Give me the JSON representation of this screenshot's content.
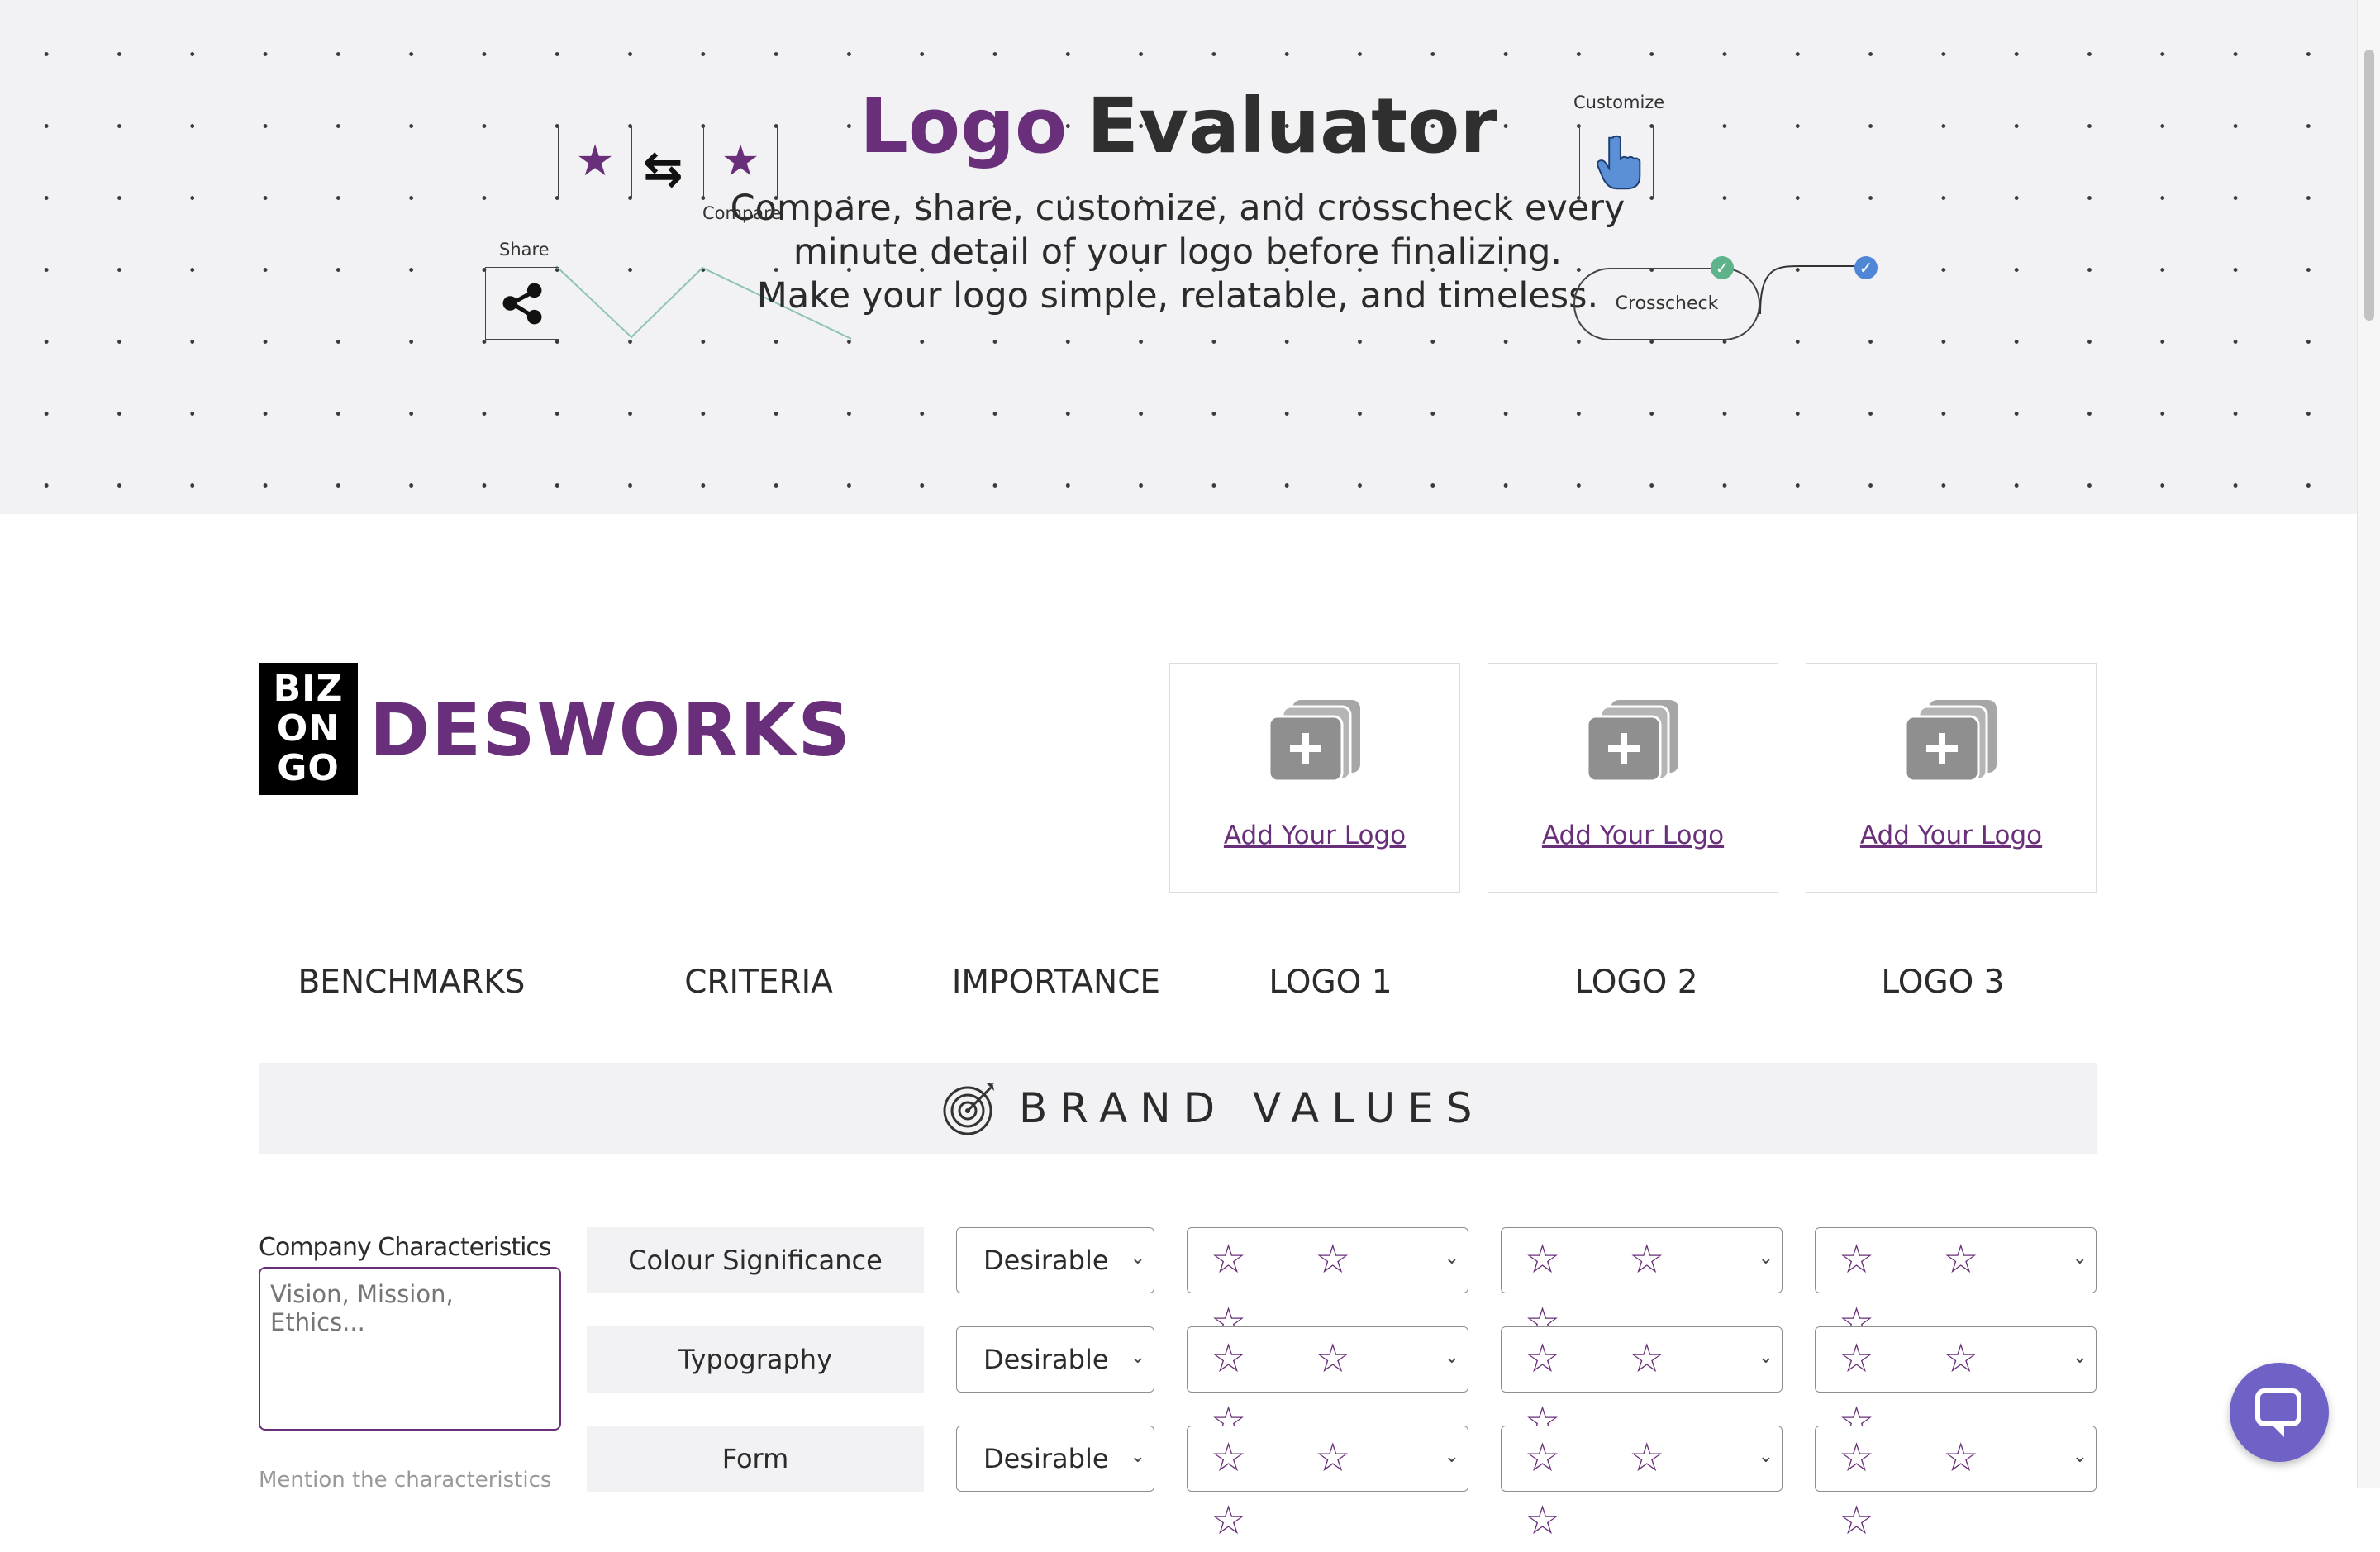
{
  "hero": {
    "title_accent": "Logo",
    "title_rest": "Evaluator",
    "subtitle_lines": [
      "Compare, share, customize, and crosscheck every",
      "minute detail of your logo before finalizing.",
      "Make your logo simple, relatable, and timeless."
    ],
    "compare_label": "Compare",
    "share_label": "Share",
    "customize_label": "Customize",
    "crosscheck_label": "Crosscheck",
    "colors": {
      "accent": "#6a2f7a",
      "check_green": "#5fb38a",
      "check_blue": "#4f86d6"
    }
  },
  "brand": {
    "mark_lines": [
      "BIZ",
      "ON",
      "GO"
    ],
    "wordmark": "DESWORKS"
  },
  "uploads": [
    {
      "link_text": "Add Your Logo"
    },
    {
      "link_text": "Add Your Logo"
    },
    {
      "link_text": "Add Your Logo"
    }
  ],
  "columns": [
    "BENCHMARKS",
    "CRITERIA",
    "IMPORTANCE",
    "LOGO 1",
    "LOGO 2",
    "LOGO 3"
  ],
  "section": {
    "title": "BRAND VALUES",
    "icon": "target-icon",
    "characteristics_label": "Company Characteristics",
    "characteristics_placeholder": "Vision, Mission, Ethics...",
    "characteristics_note": "Mention the characteristics"
  },
  "rows": [
    {
      "criteria": "Colour Significance",
      "importance": "Desirable",
      "ratings": [
        "☆ ☆ ☆",
        "☆ ☆ ☆",
        "☆ ☆ ☆"
      ]
    },
    {
      "criteria": "Typography",
      "importance": "Desirable",
      "ratings": [
        "☆ ☆ ☆",
        "☆ ☆ ☆",
        "☆ ☆ ☆"
      ]
    },
    {
      "criteria": "Form",
      "importance": "Desirable",
      "ratings": [
        "☆ ☆ ☆",
        "☆ ☆ ☆",
        "☆ ☆ ☆"
      ]
    }
  ],
  "chat": {
    "icon": "chat-bubble-icon"
  }
}
